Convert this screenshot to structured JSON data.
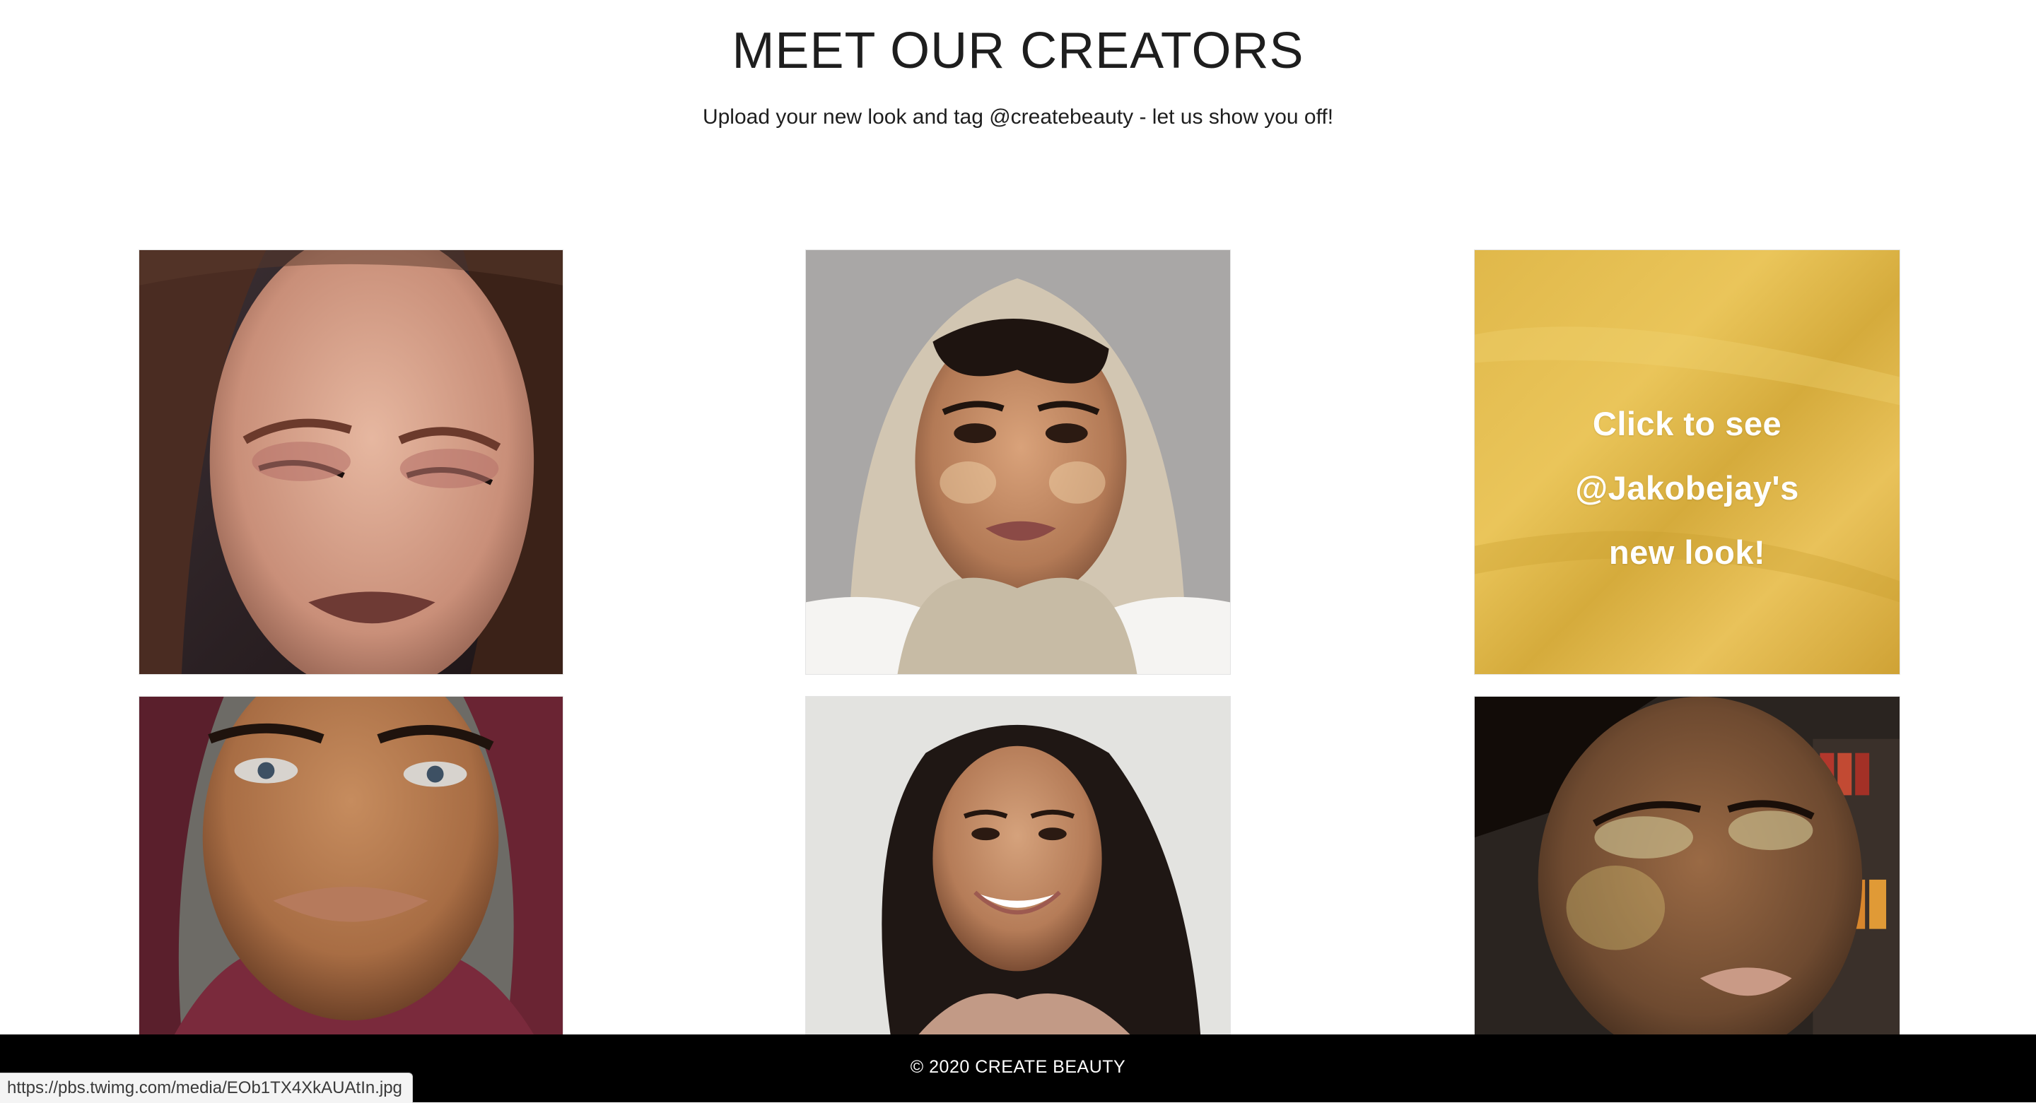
{
  "header": {
    "title": "MEET OUR CREATORS",
    "subtitle": "Upload your new look and tag @createbeauty - let us show you off!"
  },
  "creators": [
    {
      "image": "portrait with dramatic winged eyeliner and rose eyeshadow"
    },
    {
      "image": "portrait in beige hijab with highlighted cheekbones"
    },
    {
      "image": "gold foil card",
      "promo_lines": [
        "Click to see",
        "@Jakobejay's",
        "new look!"
      ]
    },
    {
      "image": "portrait in burgundy hijab with nude lips"
    },
    {
      "image": "smiling portrait with long dark hair"
    },
    {
      "image": "portrait with gold eyeshadow and glossy lips"
    }
  ],
  "footer": {
    "copyright": "© 2020 CREATE BEAUTY"
  },
  "status_bar": {
    "url": "https://pbs.twimg.com/media/EOb1TX4XkAUAtIn.jpg"
  },
  "colors": {
    "background": "#ffffff",
    "text": "#1e1e1e",
    "footer_bg": "#000000",
    "footer_text": "#ffffff",
    "promo_gold": "#d9b13e"
  }
}
